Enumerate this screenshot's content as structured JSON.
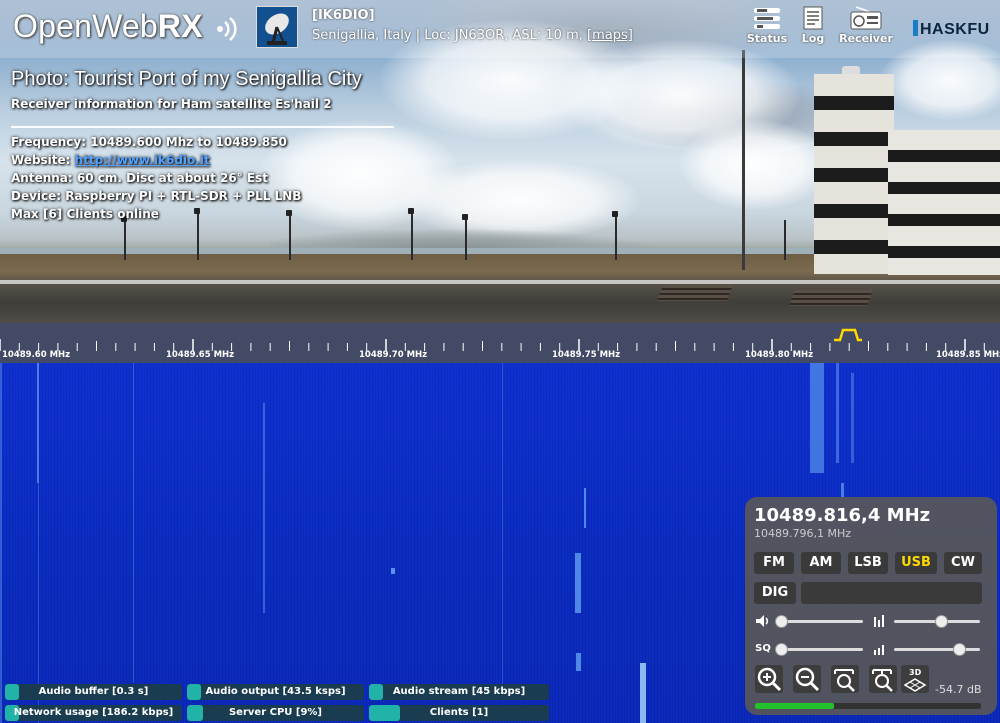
{
  "header": {
    "logo_open": "Open",
    "logo_web": "Web",
    "logo_rx": "RX",
    "callsign": "[IK6DIO]",
    "location": "Senigallia, Italy | Loc: JN63OR, ASL: 10 m,",
    "maps_link": "[maps]",
    "buttons": [
      {
        "label": "Status",
        "icon": "status-icon"
      },
      {
        "label": "Log",
        "icon": "log-icon"
      },
      {
        "label": "Receiver",
        "icon": "receiver-icon"
      }
    ],
    "brand": "HASKFU"
  },
  "info": {
    "title": "Photo: Tourist Port of my Senigallia City",
    "subtitle": "Receiver information for Ham satellite Es'hail 2",
    "frequency": "Frequency: 10489.600 Mhz to 10489.850",
    "website_label": "Website: ",
    "website_link": "http://www.ik6dio.it",
    "antenna": "Antenna: 60 cm. Disc at about 26° Est",
    "device": "Device: Raspberry PI + RTL-SDR + PLL LNB",
    "clients": "Max [6] Clients online"
  },
  "scale": {
    "labels": [
      "10489.60 MHz",
      "10489.65 MHz",
      "10489.70 MHz",
      "10489.75 MHz",
      "10489.80 MHz",
      "10489.85 MHz"
    ]
  },
  "panel": {
    "frequency": "10489.816,4 MHz",
    "sub_frequency": "10489.796,1 MHz",
    "modes": [
      "FM",
      "AM",
      "LSB",
      "USB",
      "CW"
    ],
    "selected_mode": "USB",
    "dig_label": "DIG",
    "sliders": {
      "volume_icon": "speaker-icon",
      "squelch_label": "SQ",
      "volume_level": 0.05,
      "waterfall_max_level": 0.55,
      "squelch_level": 0.05,
      "waterfall_min_level": 0.75
    },
    "db": "-54.7 dB",
    "smeter_level": 0.35
  },
  "status_bars": [
    {
      "label": "Audio buffer [0.3 s]",
      "level": 0.08
    },
    {
      "label": "Audio output [43.5 ksps]",
      "level": 0.06
    },
    {
      "label": "Audio stream [45 kbps]",
      "level": 0.08
    },
    {
      "label": "Network usage [186.2 kbps]",
      "level": 0.06
    },
    {
      "label": "Server CPU [9%]",
      "level": 0.09
    },
    {
      "label": "Clients [1]",
      "level": 0.17
    }
  ],
  "colors": {
    "waterfall_bg": "#0b2bc0",
    "accent_selected": "#ffd800",
    "status_fill": "#22b3a8",
    "smeter": "#24c02e"
  }
}
